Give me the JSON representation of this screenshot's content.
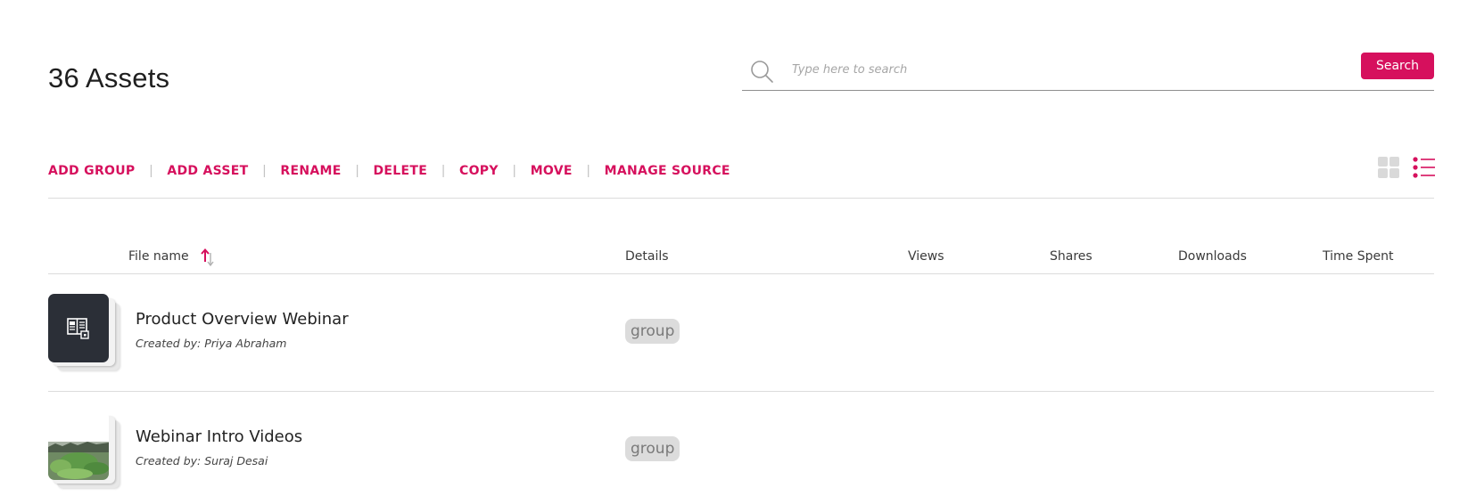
{
  "header": {
    "title": "36 Assets"
  },
  "search": {
    "placeholder": "Type here to search",
    "value": "",
    "button_label": "Search",
    "icon": "search-icon"
  },
  "toolbar": {
    "items": [
      "ADD GROUP",
      "ADD ASSET",
      "RENAME",
      "DELETE",
      "COPY",
      "MOVE",
      "MANAGE SOURCE"
    ],
    "separator": "|"
  },
  "view_toggle": {
    "grid_icon": "grid-view-icon",
    "list_icon": "list-view-icon",
    "active": "list"
  },
  "table": {
    "columns": {
      "file_name": "File name",
      "details": "Details",
      "views": "Views",
      "shares": "Shares",
      "downloads": "Downloads",
      "time_spent": "Time Spent"
    },
    "sort_icon": "sort-arrows-icon",
    "rows": [
      {
        "name": "Product Overview Webinar",
        "created_by_label": "Created by:",
        "created_by": "Priya Abraham",
        "type": "group",
        "thumbnail_icon": "document-gallery-icon"
      },
      {
        "name": "Webinar Intro Videos",
        "created_by_label": "Created by:",
        "created_by": "Suraj Desai",
        "type": "group",
        "thumbnail_icon": "landscape-photo-thumbnail"
      }
    ]
  },
  "colors": {
    "accent": "#d6105d",
    "muted_icon": "#d9d9d9",
    "badge_bg": "#dcdcdc",
    "thumb_dark": "#2b2f37"
  }
}
